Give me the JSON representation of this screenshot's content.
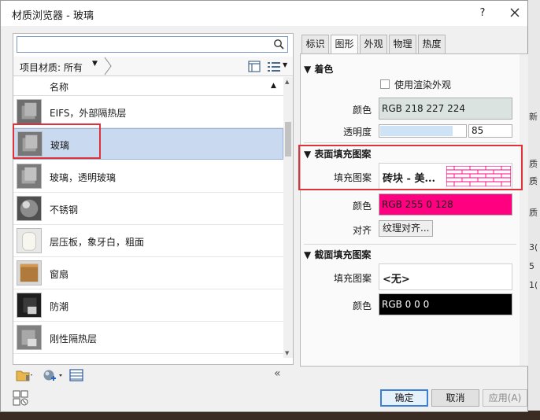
{
  "window": {
    "title": "材质浏览器 - 玻璃",
    "help": "?"
  },
  "backdrop": {
    "right_glyphs": [
      "新",
      "质",
      "质",
      "质",
      "3(",
      "5",
      "1("
    ]
  },
  "library": {
    "search_placeholder": "",
    "filter_label": "项目材质: 所有",
    "column_name": "名称",
    "items": [
      {
        "label": "EIFS，外部隔热层",
        "thumb": "gray-block"
      },
      {
        "label": "玻璃",
        "thumb": "gray-block",
        "selected": true
      },
      {
        "label": "玻璃，透明玻璃",
        "thumb": "gray-block"
      },
      {
        "label": "不锈钢",
        "thumb": "steel-sphere"
      },
      {
        "label": "层压板，象牙白，粗面",
        "thumb": "ivory-cylinder"
      },
      {
        "label": "窗扇",
        "thumb": "wood-block"
      },
      {
        "label": "防潮",
        "thumb": "dark-block"
      },
      {
        "label": "刚性隔热层",
        "thumb": "gray-block"
      },
      {
        "label": "",
        "thumb": "gray-block"
      }
    ]
  },
  "tabs": [
    {
      "label": "标识",
      "active": false
    },
    {
      "label": "图形",
      "active": true
    },
    {
      "label": "外观",
      "active": false
    },
    {
      "label": "物理",
      "active": false
    },
    {
      "label": "热度",
      "active": false
    }
  ],
  "shading": {
    "title": "着色",
    "use_render_label": "使用渲染外观",
    "color_label": "颜色",
    "color_value": "RGB 218 227 224",
    "color_hex": "#dae3e0",
    "transparency_label": "透明度",
    "transparency_value": "85",
    "transparency_fraction": 0.85
  },
  "surface": {
    "title": "表面填充图案",
    "pattern_label": "填充图案",
    "pattern_value": "砖块 - 美...",
    "color_label": "颜色",
    "color_value": "RGB 255 0 128",
    "color_hex": "#ff0080",
    "align_label": "对齐",
    "align_button": "纹理对齐..."
  },
  "cut": {
    "title": "截面填充图案",
    "pattern_label": "填充图案",
    "pattern_value": "<无>",
    "color_label": "颜色",
    "color_value": "RGB 0 0 0",
    "color_hex": "#000000"
  },
  "buttons": {
    "ok": "确定",
    "cancel": "取消",
    "apply": "应用(A)"
  }
}
